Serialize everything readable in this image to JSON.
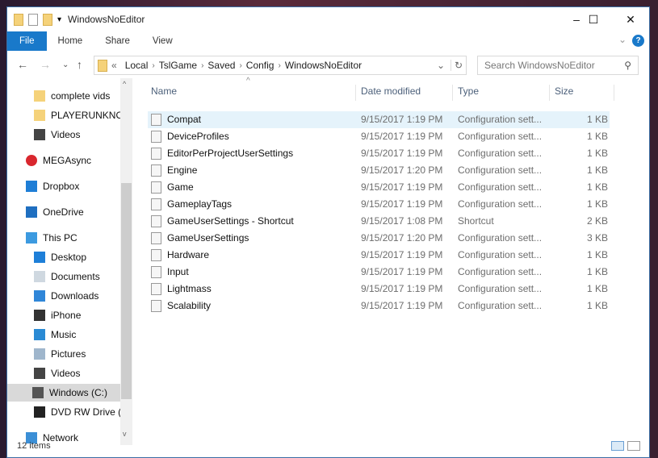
{
  "window": {
    "title": "WindowsNoEditor",
    "minimize": "–",
    "maximize": "☐",
    "close": "✕"
  },
  "ribbon": {
    "tabs": [
      "File",
      "Home",
      "Share",
      "View"
    ],
    "help": "?",
    "expand": "⌄"
  },
  "nav": {
    "back": "←",
    "forward": "→",
    "recent": "⌄",
    "up": "↑",
    "refresh": "↻",
    "dropdown": "⌄",
    "overflow": "«",
    "breadcrumb": [
      "Local",
      "TslGame",
      "Saved",
      "Config",
      "WindowsNoEditor"
    ],
    "search_placeholder": "Search WindowsNoEditor"
  },
  "sidebar": {
    "items": [
      {
        "label": "complete vids",
        "icon": "folder-icon"
      },
      {
        "label": "PLAYERUNKNOWN",
        "icon": "folder-icon"
      },
      {
        "label": "Videos",
        "icon": "videos-icon"
      },
      {
        "label": "MEGAsync",
        "icon": "megasync-icon"
      },
      {
        "label": "Dropbox",
        "icon": "dropbox-icon"
      },
      {
        "label": "OneDrive",
        "icon": "onedrive-icon"
      },
      {
        "label": "This PC",
        "icon": "computer-icon"
      },
      {
        "label": "Desktop",
        "icon": "desktop-icon"
      },
      {
        "label": "Documents",
        "icon": "documents-icon"
      },
      {
        "label": "Downloads",
        "icon": "downloads-icon"
      },
      {
        "label": "iPhone",
        "icon": "phone-icon"
      },
      {
        "label": "Music",
        "icon": "music-icon"
      },
      {
        "label": "Pictures",
        "icon": "pictures-icon"
      },
      {
        "label": "Videos",
        "icon": "videos-icon"
      },
      {
        "label": "Windows (C:)",
        "icon": "drive-icon"
      },
      {
        "label": "DVD RW Drive (D:)",
        "icon": "dvd-icon"
      },
      {
        "label": "Network",
        "icon": "network-icon"
      }
    ]
  },
  "columns": {
    "name": "Name",
    "date": "Date modified",
    "type": "Type",
    "size": "Size",
    "sort": "^"
  },
  "files": [
    {
      "name": "Compat",
      "date": "9/15/2017 1:19 PM",
      "type": "Configuration sett...",
      "size": "1 KB"
    },
    {
      "name": "DeviceProfiles",
      "date": "9/15/2017 1:19 PM",
      "type": "Configuration sett...",
      "size": "1 KB"
    },
    {
      "name": "EditorPerProjectUserSettings",
      "date": "9/15/2017 1:19 PM",
      "type": "Configuration sett...",
      "size": "1 KB"
    },
    {
      "name": "Engine",
      "date": "9/15/2017 1:20 PM",
      "type": "Configuration sett...",
      "size": "1 KB"
    },
    {
      "name": "Game",
      "date": "9/15/2017 1:19 PM",
      "type": "Configuration sett...",
      "size": "1 KB"
    },
    {
      "name": "GameplayTags",
      "date": "9/15/2017 1:19 PM",
      "type": "Configuration sett...",
      "size": "1 KB"
    },
    {
      "name": "GameUserSettings - Shortcut",
      "date": "9/15/2017 1:08 PM",
      "type": "Shortcut",
      "size": "2 KB"
    },
    {
      "name": "GameUserSettings",
      "date": "9/15/2017 1:20 PM",
      "type": "Configuration sett...",
      "size": "3 KB"
    },
    {
      "name": "Hardware",
      "date": "9/15/2017 1:19 PM",
      "type": "Configuration sett...",
      "size": "1 KB"
    },
    {
      "name": "Input",
      "date": "9/15/2017 1:19 PM",
      "type": "Configuration sett...",
      "size": "1 KB"
    },
    {
      "name": "Lightmass",
      "date": "9/15/2017 1:19 PM",
      "type": "Configuration sett...",
      "size": "1 KB"
    },
    {
      "name": "Scalability",
      "date": "9/15/2017 1:19 PM",
      "type": "Configuration sett...",
      "size": "1 KB"
    }
  ],
  "status": {
    "count": "12 items"
  }
}
